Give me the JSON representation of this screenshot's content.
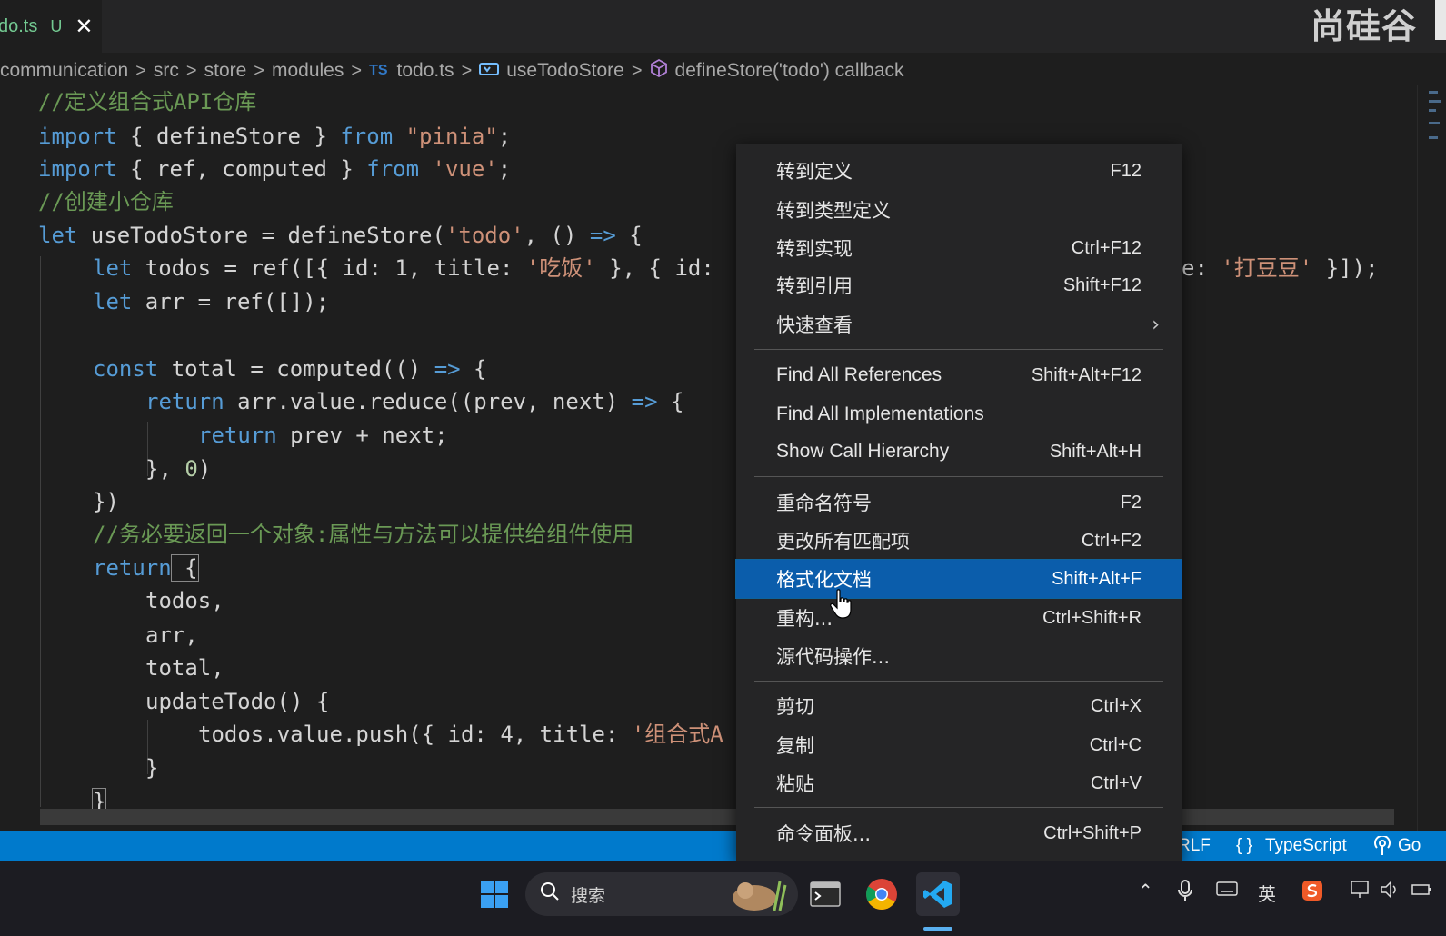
{
  "tab": {
    "filename": "do.ts",
    "status": "U",
    "close": "✕"
  },
  "watermark": "尚硅谷",
  "breadcrumb": {
    "items": [
      "communication",
      "src",
      "store",
      "modules"
    ],
    "file_badge": "TS",
    "file": "todo.ts",
    "symbol": "useTodoStore",
    "callback": "defineStore('todo') callback"
  },
  "code": {
    "l1": "//定义组合式API仓库",
    "l2_kw1": "import",
    "l2_mid": " { defineStore } ",
    "l2_kw2": "from",
    "l2_str": " \"pinia\"",
    "l2_end": ";",
    "l3_kw1": "import",
    "l3_mid": " { ref, computed } ",
    "l3_kw2": "from",
    "l3_str": " 'vue'",
    "l3_end": ";",
    "l4": "//创建小仓库",
    "l5_kw": "let",
    "l5_a": " useTodoStore = defineStore(",
    "l5_str": "'todo'",
    "l5_b": ", () ",
    "l5_arrow": "=>",
    "l5_c": " {",
    "l6_kw": "let",
    "l6_a": " todos = ref([{ id: 1, title: ",
    "l6_str": "'吃饭'",
    "l6_b": " }, { id:",
    "l6_tail_a": "e: ",
    "l6_tail_str": "'打豆豆'",
    "l6_tail_b": " }]);",
    "l7_kw": "let",
    "l7_a": " arr = ref([]);",
    "l9_kw": "const",
    "l9_a": " total = computed(() ",
    "l9_arrow": "=>",
    "l9_b": " {",
    "l10_kw": "return",
    "l10_a": " arr.value.reduce((prev, next) ",
    "l10_arrow": "=>",
    "l10_b": " {",
    "l11_kw": "return",
    "l11_a": " prev + next;",
    "l12_a": "}, ",
    "l12_num": "0",
    "l12_b": ")",
    "l13": "})",
    "l14": "//务必要返回一个对象:属性与方法可以提供给组件使用",
    "l15_kw": "return",
    "l15_a": " {",
    "l16": "todos,",
    "l17": "arr,",
    "l18": "total,",
    "l19": "updateTodo() {",
    "l20_a": "todos.value.push({ id: 4, title: ",
    "l20_str": "'组合式A",
    "l21": "}",
    "l22": "}"
  },
  "menu": {
    "items": [
      {
        "label": "转到定义",
        "key": "F12"
      },
      {
        "label": "转到类型定义",
        "key": ""
      },
      {
        "label": "转到实现",
        "key": "Ctrl+F12"
      },
      {
        "label": "转到引用",
        "key": "Shift+F12"
      },
      {
        "label": "快速查看",
        "key": "",
        "arrow": "›"
      },
      {
        "label": "Find All References",
        "key": "Shift+Alt+F12"
      },
      {
        "label": "Find All Implementations",
        "key": ""
      },
      {
        "label": "Show Call Hierarchy",
        "key": "Shift+Alt+H"
      },
      {
        "label": "重命名符号",
        "key": "F2"
      },
      {
        "label": "更改所有匹配项",
        "key": "Ctrl+F2"
      },
      {
        "label": "格式化文档",
        "key": "Shift+Alt+F"
      },
      {
        "label": "重构...",
        "key": "Ctrl+Shift+R"
      },
      {
        "label": "源代码操作...",
        "key": ""
      },
      {
        "label": "剪切",
        "key": "Ctrl+X"
      },
      {
        "label": "复制",
        "key": "Ctrl+C"
      },
      {
        "label": "粘贴",
        "key": "Ctrl+V"
      },
      {
        "label": "命令面板...",
        "key": "Ctrl+Shift+P"
      }
    ]
  },
  "statusbar": {
    "eol": "RLF",
    "language_icon": "{ }",
    "language": "TypeScript",
    "golive": "Go"
  },
  "taskbar": {
    "search_placeholder": "搜索",
    "ime": "英"
  },
  "colors": {
    "accent": "#007acc",
    "menu_active": "#0b5dab",
    "keyword": "#569cd6",
    "string": "#ce9178",
    "comment": "#6a9955"
  }
}
